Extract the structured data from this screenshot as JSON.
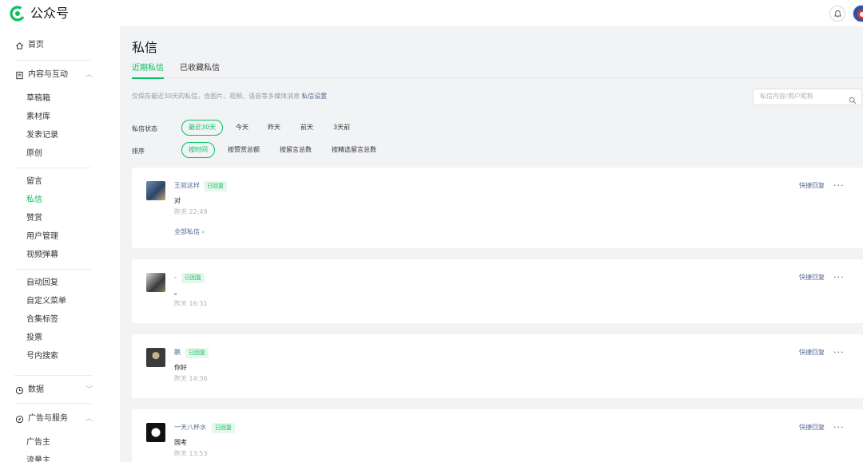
{
  "app": {
    "name": "公众号",
    "brand_color": "#07c160",
    "link_color": "#576b95"
  },
  "topbar": {
    "bell_icon": "bell-icon",
    "avatar_icon": "user-avatar"
  },
  "sidebar": {
    "home": "首页",
    "group_content": "内容与互动",
    "content_items": [
      "草稿箱",
      "素材库",
      "发表记录",
      "原创"
    ],
    "interact_items": [
      "留言",
      "私信",
      "赞赏",
      "用户管理",
      "视频弹幕"
    ],
    "active_item": "私信",
    "feature_items": [
      "自动回复",
      "自定义菜单",
      "合集标签",
      "投票",
      "号内搜索"
    ],
    "group_data": "数据",
    "group_ads": "广告与服务",
    "ads_items": [
      "广告主",
      "流量主"
    ]
  },
  "page": {
    "title": "私信",
    "tabs": [
      "近期私信",
      "已收藏私信"
    ],
    "active_tab": "近期私信",
    "notice": "仅保存最近30天的私信，含图片、视频、语音等多媒体消息",
    "notice_link": "私信设置",
    "search_placeholder": "私信内容/用户昵称"
  },
  "filters": {
    "status_label": "私信状态",
    "status_options": [
      "最近30天",
      "今天",
      "昨天",
      "前天",
      "3天前"
    ],
    "status_selected": "最近30天",
    "sort_label": "排序",
    "sort_options": [
      "按时间",
      "按赞赏总额",
      "按留言总数",
      "按精选留言总数"
    ],
    "sort_selected": "按时间"
  },
  "messages": [
    {
      "name": "王就这样",
      "badge": "已回复",
      "text": "对",
      "time": "昨天 22:49",
      "all_link": "全部私信 ›",
      "quick_reply": "快捷回复",
      "more": "···"
    },
    {
      "name": "-",
      "badge": "已回复",
      "text": "。",
      "time": "昨天 16:31",
      "quick_reply": "快捷回复",
      "more": "···"
    },
    {
      "name": "鹏",
      "badge": "已回复",
      "text": "你好",
      "time": "昨天 14:36",
      "quick_reply": "快捷回复",
      "more": "···"
    },
    {
      "name": "一天八杯水",
      "badge": "已回复",
      "text": "国考",
      "time": "昨天 13:53",
      "quick_reply": "快捷回复",
      "more": "···"
    }
  ]
}
